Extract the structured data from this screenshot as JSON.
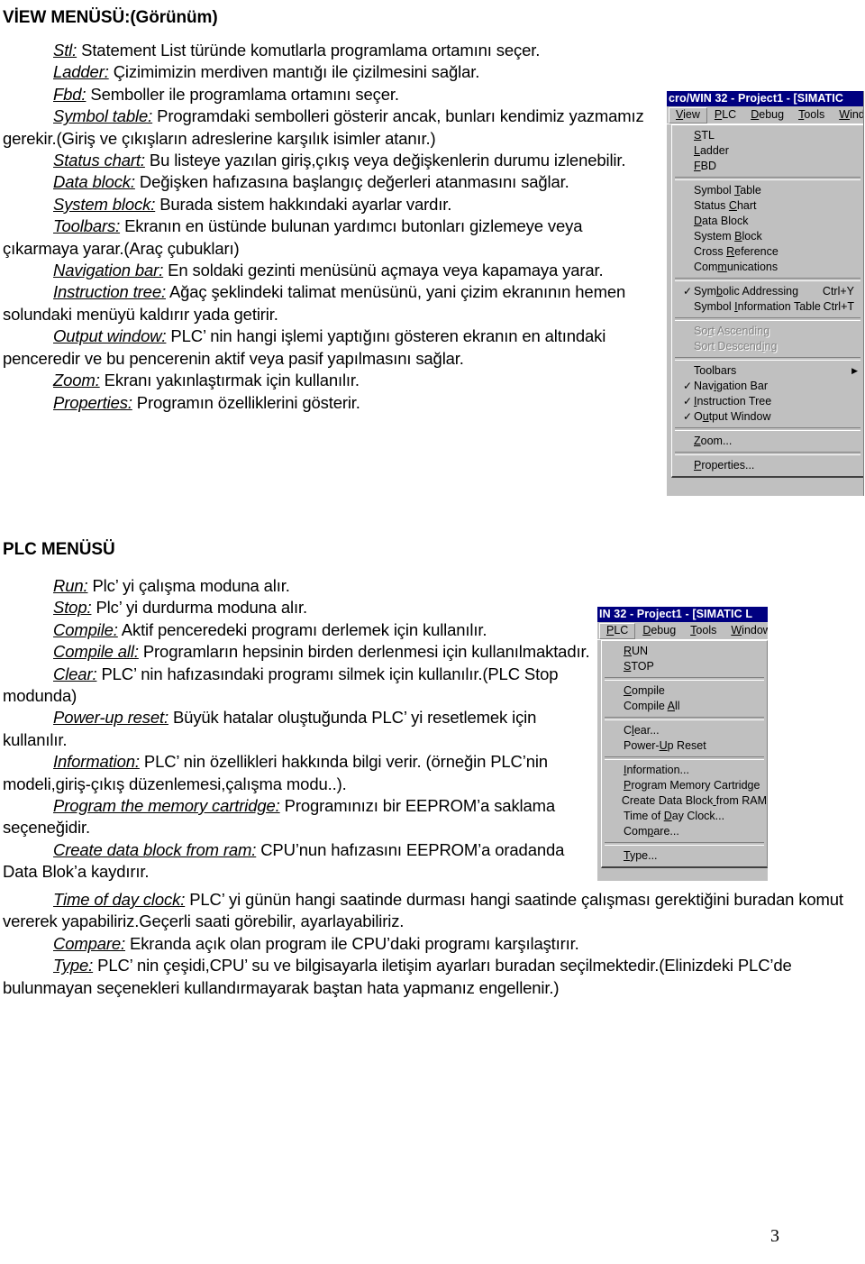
{
  "view_section": {
    "heading_bold": "VİEW MENÜSÜ:",
    "heading_rest": "(Görünüm)",
    "items": [
      {
        "term": "Stl:",
        "text": " Statement List türünde komutlarla programlama ortamını seçer."
      },
      {
        "term": "Ladder:",
        "text": " Çizimimizin merdiven mantığı ile çizilmesini sağlar."
      },
      {
        "term": "Fbd:",
        "text": " Semboller ile programlama ortamını seçer."
      },
      {
        "term": "Symbol table:",
        "text": " Programdaki sembolleri gösterir ancak, bunları kendimiz yazmamız gerekir.(Giriş ve çıkışların adreslerine karşılık isimler atanır.)"
      },
      {
        "term": "Status chart:",
        "text": " Bu listeye yazılan giriş,çıkış veya değişkenlerin durumu izlenebilir."
      },
      {
        "term": "Data block:",
        "text": " Değişken hafızasına başlangıç değerleri atanmasını sağlar."
      },
      {
        "term": " System block:",
        "text": " Burada sistem hakkındaki ayarlar vardır."
      },
      {
        "term": "Toolbars:",
        "text": " Ekranın en üstünde bulunan yardımcı butonları gizlemeye veya çıkarmaya yarar.(Araç çubukları)"
      },
      {
        "term": "Navigation bar:",
        "text": " En soldaki gezinti menüsünü açmaya veya kapamaya yarar."
      },
      {
        "term": "Instruction tree:",
        "text": " Ağaç şeklindeki talimat menüsünü, yani çizim ekranının hemen solundaki menüyü kaldırır yada getirir."
      },
      {
        "term": "Output window:",
        "text": " PLC’ nin hangi işlemi yaptığını gösteren ekranın en altındaki  penceredir ve bu pencerenin aktif veya pasif yapılmasını sağlar."
      },
      {
        "term": "Zoom:",
        "text": " Ekranı yakınlaştırmak için kullanılır."
      },
      {
        "term": "Properties:",
        "text": " Programın özelliklerini gösterir."
      }
    ]
  },
  "plc_section": {
    "heading": "PLC MENÜSÜ",
    "items": [
      {
        "term": "Run:",
        "text": " Plc’ yi çalışma moduna alır."
      },
      {
        "term": "Stop:",
        "text": " Plc’ yi durdurma moduna alır."
      },
      {
        "term": "Compile:",
        "text": " Aktif penceredeki programı derlemek için kullanılır."
      },
      {
        "term": "Compile all:",
        "text": " Programların hepsinin birden derlenmesi için kullanılmaktadır."
      },
      {
        "term": "Clear:",
        "text": " PLC’ nin hafızasındaki programı silmek için kullanılır.(PLC Stop modunda)"
      },
      {
        "term": "Power-up reset:",
        "text": " Büyük hatalar oluştuğunda PLC’ yi resetlemek için kullanılır."
      },
      {
        "term": "Information:",
        "text": " PLC’ nin özellikleri hakkında bilgi verir. (örneğin PLC’nin modeli,giriş-çıkış düzenlemesi,çalışma modu..)."
      },
      {
        "term": "Program the memory cartridge:",
        "text": " Programınızı bir EEPROM’a saklama seçeneğidir."
      },
      {
        "term": "Create data block from ram:",
        "text": " CPU’nun hafızasını EEPROM’a oradanda Data Blok’a kaydırır."
      }
    ],
    "items_wide": [
      {
        "term": "Time of day clock:",
        "text": " PLC’ yi günün hangi saatinde durması hangi saatinde çalışması gerektiğini buradan komut vererek yapabiliriz.Geçerli saati görebilir, ayarlayabiliriz."
      },
      {
        "term": "Compare:",
        "text": " Ekranda açık olan program ile CPU’daki programı karşılaştırır."
      },
      {
        "term": "Type:",
        "text": " PLC’ nin çeşidi,CPU’ su ve bilgisayarla iletişim ayarları buradan seçilmektedir.(Elinizdeki PLC’de bulunmayan seçenekleri kullandırmayarak baştan hata yapmanız engellenir.)"
      }
    ]
  },
  "view_window": {
    "title": "cro/WIN 32 - Project1 - [SIMATIC",
    "menubar": [
      {
        "label": "View",
        "accel_index": 0,
        "active": true
      },
      {
        "label": "PLC",
        "accel_index": 0,
        "active": false
      },
      {
        "label": "Debug",
        "accel_index": 0,
        "active": false
      },
      {
        "label": "Tools",
        "accel_index": 0,
        "active": false
      },
      {
        "label": "Windows",
        "accel_index": 0,
        "active": false
      }
    ],
    "menu_items": [
      {
        "label": "STL",
        "accel_index": 0,
        "checked": false,
        "accel": "",
        "disabled": false,
        "submenu": false
      },
      {
        "label": "Ladder",
        "accel_index": 0,
        "checked": false,
        "accel": "",
        "disabled": false,
        "submenu": false
      },
      {
        "label": "FBD",
        "accel_index": 0,
        "checked": false,
        "accel": "",
        "disabled": false,
        "submenu": false
      },
      {
        "separator": true
      },
      {
        "label": "Symbol Table",
        "accel_index": 7,
        "checked": false,
        "accel": "",
        "disabled": false,
        "submenu": false
      },
      {
        "label": "Status Chart",
        "accel_index": 7,
        "checked": false,
        "accel": "",
        "disabled": false,
        "submenu": false
      },
      {
        "label": "Data Block",
        "accel_index": 0,
        "checked": false,
        "accel": "",
        "disabled": false,
        "submenu": false
      },
      {
        "label": "System Block",
        "accel_index": 7,
        "checked": false,
        "accel": "",
        "disabled": false,
        "submenu": false
      },
      {
        "label": "Cross Reference",
        "accel_index": 6,
        "checked": false,
        "accel": "",
        "disabled": false,
        "submenu": false
      },
      {
        "label": "Communications",
        "accel_index": 3,
        "checked": false,
        "accel": "",
        "disabled": false,
        "submenu": false
      },
      {
        "separator": true
      },
      {
        "label": "Symbolic Addressing",
        "accel_index": 3,
        "checked": true,
        "accel": "Ctrl+Y",
        "disabled": false,
        "submenu": false
      },
      {
        "label": "Symbol Information Table",
        "accel_index": 7,
        "checked": false,
        "accel": "Ctrl+T",
        "disabled": false,
        "submenu": false
      },
      {
        "separator": true
      },
      {
        "label": "Sort Ascending",
        "accel_index": 2,
        "checked": false,
        "accel": "",
        "disabled": true,
        "submenu": false
      },
      {
        "label": "Sort Descending",
        "accel_index": 12,
        "checked": false,
        "accel": "",
        "disabled": true,
        "submenu": false
      },
      {
        "separator": true
      },
      {
        "label": "Toolbars",
        "accel_index": -1,
        "checked": false,
        "accel": "",
        "disabled": false,
        "submenu": true
      },
      {
        "label": "Navigation Bar",
        "accel_index": 3,
        "checked": true,
        "accel": "",
        "disabled": false,
        "submenu": false
      },
      {
        "label": "Instruction Tree",
        "accel_index": 0,
        "checked": true,
        "accel": "",
        "disabled": false,
        "submenu": false
      },
      {
        "label": "Output Window",
        "accel_index": 1,
        "checked": true,
        "accel": "",
        "disabled": false,
        "submenu": false
      },
      {
        "separator": true
      },
      {
        "label": "Zoom...",
        "accel_index": 0,
        "checked": false,
        "accel": "",
        "disabled": false,
        "submenu": false
      },
      {
        "separator": true
      },
      {
        "label": "Properties...",
        "accel_index": 0,
        "checked": false,
        "accel": "",
        "disabled": false,
        "submenu": false
      }
    ]
  },
  "plc_window": {
    "title": "IN 32 - Project1 - [SIMATIC L",
    "menubar": [
      {
        "label": "PLC",
        "accel_index": 0,
        "active": true
      },
      {
        "label": "Debug",
        "accel_index": 0,
        "active": false
      },
      {
        "label": "Tools",
        "accel_index": 0,
        "active": false
      },
      {
        "label": "Windows",
        "accel_index": 0,
        "active": false
      }
    ],
    "menu_items": [
      {
        "label": "RUN",
        "accel_index": 0,
        "checked": false,
        "accel": "",
        "disabled": false,
        "submenu": false
      },
      {
        "label": "STOP",
        "accel_index": 0,
        "checked": false,
        "accel": "",
        "disabled": false,
        "submenu": false
      },
      {
        "separator": true
      },
      {
        "label": "Compile",
        "accel_index": 0,
        "checked": false,
        "accel": "",
        "disabled": false,
        "submenu": false
      },
      {
        "label": "Compile All",
        "accel_index": 8,
        "checked": false,
        "accel": "",
        "disabled": false,
        "submenu": false
      },
      {
        "separator": true
      },
      {
        "label": "Clear...",
        "accel_index": 1,
        "checked": false,
        "accel": "",
        "disabled": false,
        "submenu": false
      },
      {
        "label": "Power-Up Reset",
        "accel_index": 6,
        "checked": false,
        "accel": "",
        "disabled": false,
        "submenu": false
      },
      {
        "separator": true
      },
      {
        "label": "Information...",
        "accel_index": 0,
        "checked": false,
        "accel": "",
        "disabled": false,
        "submenu": false
      },
      {
        "label": "Program Memory Cartridge",
        "accel_index": 0,
        "checked": false,
        "accel": "",
        "disabled": false,
        "submenu": false
      },
      {
        "label": "Create Data Block from RAM",
        "accel_index": 17,
        "checked": false,
        "accel": "",
        "disabled": false,
        "submenu": false
      },
      {
        "label": "Time of Day Clock...",
        "accel_index": 8,
        "checked": false,
        "accel": "",
        "disabled": false,
        "submenu": false
      },
      {
        "label": "Compare...",
        "accel_index": 3,
        "checked": false,
        "accel": "",
        "disabled": false,
        "submenu": false
      },
      {
        "separator": true
      },
      {
        "label": "Type...",
        "accel_index": 0,
        "checked": false,
        "accel": "",
        "disabled": false,
        "submenu": false
      }
    ]
  },
  "footer": {
    "page_number": "3"
  },
  "colors": {
    "titlebar_bg": "#000080",
    "titlebar_text": "#ffffff",
    "menu_bg": "#c0c0c0",
    "menu_shadow": "#808080",
    "menu_highlight": "#ffffff",
    "disabled_text": "#808080",
    "body_text": "#000000"
  }
}
